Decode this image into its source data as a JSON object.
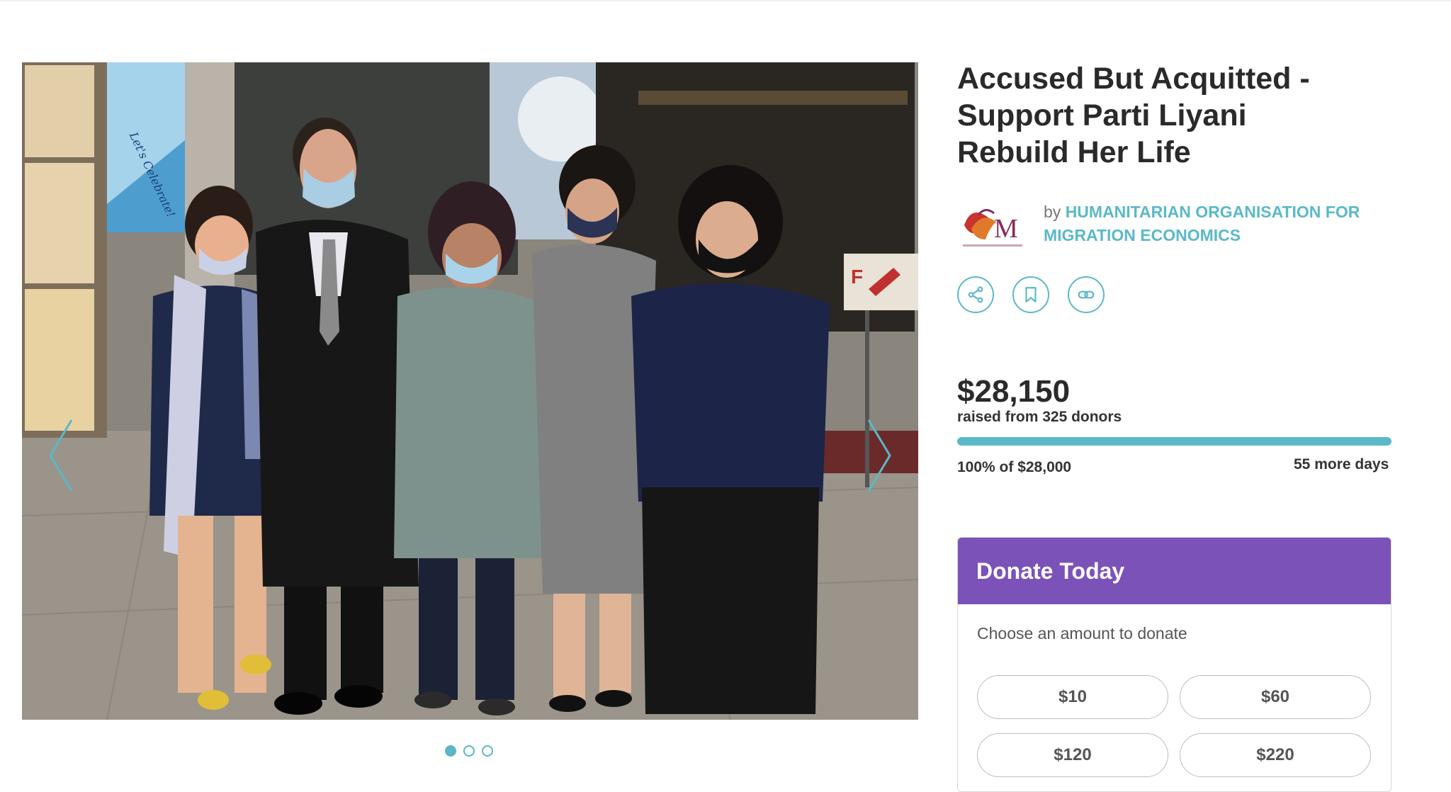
{
  "campaign": {
    "title": "Accused But Acquitted - Support Parti Liyani Rebuild Her Life",
    "by_label": "by",
    "organizer": "HUMANITARIAN ORGANISATION FOR MIGRATION ECONOMICS",
    "organizer_logo_icon": "home-logo-icon"
  },
  "photo": {
    "banner_text": "Let's Celebrate!",
    "sign_text": "F",
    "carousel_slide_count": 3,
    "active_slide": 1
  },
  "actions": [
    {
      "name": "share",
      "icon": "share-icon"
    },
    {
      "name": "bookmark",
      "icon": "bookmark-icon"
    },
    {
      "name": "copy-link",
      "icon": "link-icon"
    }
  ],
  "funding": {
    "raised": "$28,150",
    "raised_from": "raised from 325 donors",
    "percent_text": "100% of $28,000",
    "progress_fraction": 1.0,
    "days_left": "55 more days"
  },
  "donate": {
    "header": "Donate Today",
    "prompt": "Choose an amount to donate",
    "amounts": [
      "$10",
      "$60",
      "$120",
      "$220"
    ]
  },
  "colors": {
    "accent": "#5bb8c9",
    "donate_header": "#7b52b8",
    "text_dark": "#2a2a2a"
  }
}
